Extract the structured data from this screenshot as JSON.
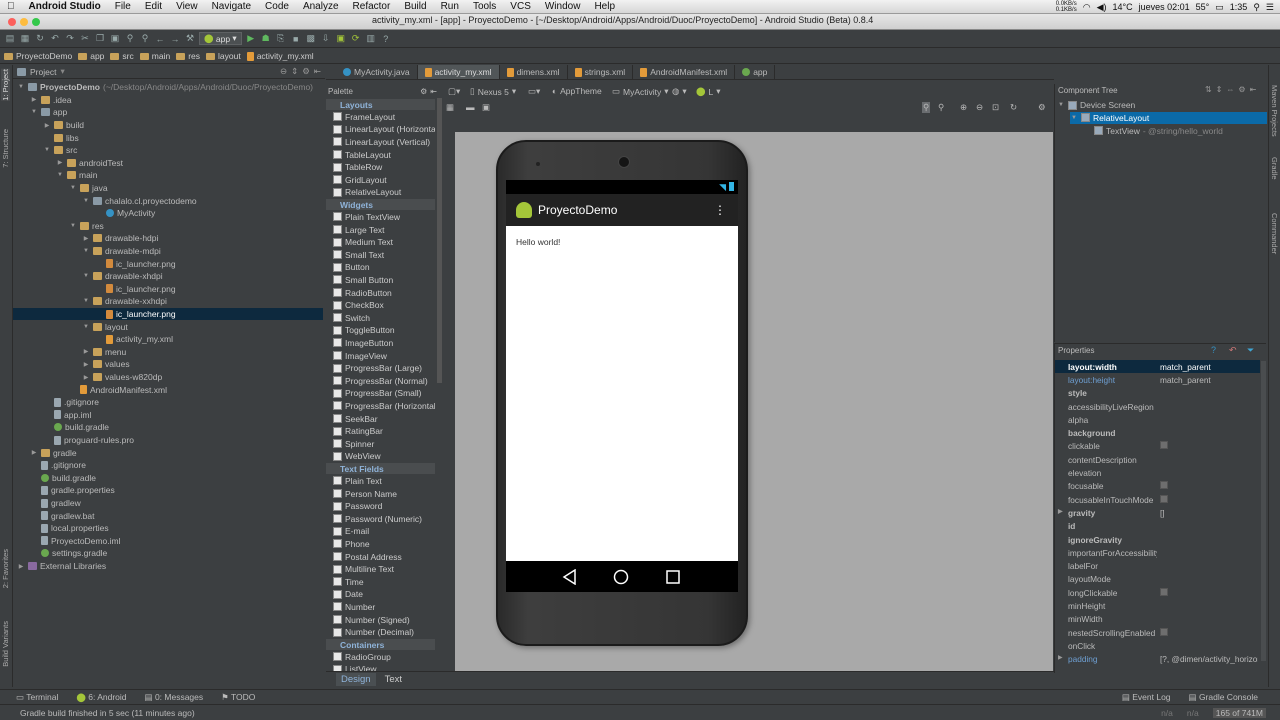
{
  "mac_menu": {
    "app_name": "Android Studio",
    "items": [
      "File",
      "Edit",
      "View",
      "Navigate",
      "Code",
      "Analyze",
      "Refactor",
      "Build",
      "Run",
      "Tools",
      "VCS",
      "Window",
      "Help"
    ]
  },
  "window_title": "activity_my.xml - [app] - ProyectoDemo - [~/Desktop/Android/Apps/Android/Duoc/ProyectoDemo] - Android Studio (Beta) 0.8.4",
  "tray": {
    "net_up": "0.0KB/s",
    "net_down": "0.1KB/s",
    "temp": "14°C",
    "cpu_temp": "55°",
    "clock_day": "jueves 02:01",
    "clock2": "1:35"
  },
  "toolbar": {
    "run_config": "app"
  },
  "breadcrumbs": [
    "ProyectoDemo",
    "app",
    "src",
    "main",
    "res",
    "layout",
    "activity_my.xml"
  ],
  "project_pane": {
    "view_name": "Project"
  },
  "tree": [
    {
      "d": 0,
      "arrow": "▼",
      "icon": "pkg",
      "label": "ProyectoDemo",
      "extra": "(~/Desktop/Android/Apps/Android/Duoc/ProyectoDemo)",
      "bold": true
    },
    {
      "d": 1,
      "arrow": "▶",
      "icon": "folder",
      "label": ".idea"
    },
    {
      "d": 1,
      "arrow": "▼",
      "icon": "pkg",
      "label": "app"
    },
    {
      "d": 2,
      "arrow": "▶",
      "icon": "folder",
      "label": "build"
    },
    {
      "d": 2,
      "arrow": "",
      "icon": "folder",
      "label": "libs"
    },
    {
      "d": 2,
      "arrow": "▼",
      "icon": "folder",
      "label": "src"
    },
    {
      "d": 3,
      "arrow": "▶",
      "icon": "folder",
      "label": "androidTest"
    },
    {
      "d": 3,
      "arrow": "▼",
      "icon": "folder",
      "label": "main"
    },
    {
      "d": 4,
      "arrow": "▼",
      "icon": "folder",
      "label": "java"
    },
    {
      "d": 5,
      "arrow": "▼",
      "icon": "pkg",
      "label": "chalalo.cl.proyectodemo"
    },
    {
      "d": 6,
      "arrow": "",
      "icon": "cls",
      "label": "MyActivity"
    },
    {
      "d": 4,
      "arrow": "▼",
      "icon": "folder",
      "label": "res"
    },
    {
      "d": 5,
      "arrow": "▶",
      "icon": "folder",
      "label": "drawable-hdpi"
    },
    {
      "d": 5,
      "arrow": "▼",
      "icon": "folder",
      "label": "drawable-mdpi"
    },
    {
      "d": 6,
      "arrow": "",
      "icon": "png",
      "label": "ic_launcher.png"
    },
    {
      "d": 5,
      "arrow": "▼",
      "icon": "folder",
      "label": "drawable-xhdpi"
    },
    {
      "d": 6,
      "arrow": "",
      "icon": "png",
      "label": "ic_launcher.png"
    },
    {
      "d": 5,
      "arrow": "▼",
      "icon": "folder",
      "label": "drawable-xxhdpi"
    },
    {
      "d": 6,
      "arrow": "",
      "icon": "png",
      "label": "ic_launcher.png",
      "sel": true
    },
    {
      "d": 5,
      "arrow": "▼",
      "icon": "folder",
      "label": "layout"
    },
    {
      "d": 6,
      "arrow": "",
      "icon": "xml",
      "label": "activity_my.xml"
    },
    {
      "d": 5,
      "arrow": "▶",
      "icon": "folder",
      "label": "menu"
    },
    {
      "d": 5,
      "arrow": "▶",
      "icon": "folder",
      "label": "values"
    },
    {
      "d": 5,
      "arrow": "▶",
      "icon": "folder",
      "label": "values-w820dp"
    },
    {
      "d": 4,
      "arrow": "",
      "icon": "xml",
      "label": "AndroidManifest.xml"
    },
    {
      "d": 2,
      "arrow": "",
      "icon": "file",
      "label": ".gitignore"
    },
    {
      "d": 2,
      "arrow": "",
      "icon": "file",
      "label": "app.iml"
    },
    {
      "d": 2,
      "arrow": "",
      "icon": "gradle",
      "label": "build.gradle"
    },
    {
      "d": 2,
      "arrow": "",
      "icon": "file",
      "label": "proguard-rules.pro"
    },
    {
      "d": 1,
      "arrow": "▶",
      "icon": "folder",
      "label": "gradle"
    },
    {
      "d": 1,
      "arrow": "",
      "icon": "file",
      "label": ".gitignore"
    },
    {
      "d": 1,
      "arrow": "",
      "icon": "gradle",
      "label": "build.gradle"
    },
    {
      "d": 1,
      "arrow": "",
      "icon": "file",
      "label": "gradle.properties"
    },
    {
      "d": 1,
      "arrow": "",
      "icon": "file",
      "label": "gradlew"
    },
    {
      "d": 1,
      "arrow": "",
      "icon": "file",
      "label": "gradlew.bat"
    },
    {
      "d": 1,
      "arrow": "",
      "icon": "file",
      "label": "local.properties"
    },
    {
      "d": 1,
      "arrow": "",
      "icon": "file",
      "label": "ProyectoDemo.iml"
    },
    {
      "d": 1,
      "arrow": "",
      "icon": "gradle",
      "label": "settings.gradle"
    },
    {
      "d": 0,
      "arrow": "▶",
      "icon": "lib",
      "label": "External Libraries"
    }
  ],
  "editor_tabs": [
    {
      "label": "MyActivity.java",
      "icon": "cls",
      "active": false
    },
    {
      "label": "activity_my.xml",
      "icon": "xml",
      "active": true
    },
    {
      "label": "dimens.xml",
      "icon": "xml",
      "active": false
    },
    {
      "label": "strings.xml",
      "icon": "xml",
      "active": false
    },
    {
      "label": "AndroidManifest.xml",
      "icon": "xml",
      "active": false
    },
    {
      "label": "app",
      "icon": "gradle",
      "active": false
    }
  ],
  "palette": {
    "title": "Palette",
    "groups": [
      {
        "name": "Layouts",
        "items": [
          "FrameLayout",
          "LinearLayout (Horizontal)",
          "LinearLayout (Vertical)",
          "TableLayout",
          "TableRow",
          "GridLayout",
          "RelativeLayout"
        ]
      },
      {
        "name": "Widgets",
        "items": [
          "Plain TextView",
          "Large Text",
          "Medium Text",
          "Small Text",
          "Button",
          "Small Button",
          "RadioButton",
          "CheckBox",
          "Switch",
          "ToggleButton",
          "ImageButton",
          "ImageView",
          "ProgressBar (Large)",
          "ProgressBar (Normal)",
          "ProgressBar (Small)",
          "ProgressBar (Horizontal)",
          "SeekBar",
          "RatingBar",
          "Spinner",
          "WebView"
        ]
      },
      {
        "name": "Text Fields",
        "items": [
          "Plain Text",
          "Person Name",
          "Password",
          "Password (Numeric)",
          "E-mail",
          "Phone",
          "Postal Address",
          "Multiline Text",
          "Time",
          "Date",
          "Number",
          "Number (Signed)",
          "Number (Decimal)"
        ]
      },
      {
        "name": "Containers",
        "items": [
          "RadioGroup",
          "ListView"
        ]
      }
    ]
  },
  "designer": {
    "device": "Nexus 5",
    "theme": "AppTheme",
    "activity": "MyActivity",
    "api": "L"
  },
  "phone": {
    "app_title": "ProyectoDemo",
    "hello_text": "Hello world!"
  },
  "designer_tabs": {
    "design": "Design",
    "text": "Text"
  },
  "component_tree": {
    "title": "Component Tree",
    "nodes": [
      {
        "d": 0,
        "label": "Device Screen",
        "extra": ""
      },
      {
        "d": 1,
        "label": "RelativeLayout",
        "extra": "",
        "sel": true
      },
      {
        "d": 2,
        "label": "TextView",
        "extra": " - @string/hello_world"
      }
    ]
  },
  "properties": {
    "title": "Properties",
    "rows": [
      {
        "n": "layout:width",
        "v": "match_parent",
        "b": true,
        "sel": true
      },
      {
        "n": "layout:height",
        "v": "match_parent",
        "blue": true
      },
      {
        "n": "style",
        "v": "",
        "b": true
      },
      {
        "n": "accessibilityLiveRegion",
        "v": ""
      },
      {
        "n": "alpha",
        "v": ""
      },
      {
        "n": "background",
        "v": "",
        "b": true
      },
      {
        "n": "clickable",
        "v": "",
        "chk": true
      },
      {
        "n": "contentDescription",
        "v": ""
      },
      {
        "n": "elevation",
        "v": ""
      },
      {
        "n": "focusable",
        "v": "",
        "chk": true
      },
      {
        "n": "focusableInTouchMode",
        "v": "",
        "chk": true
      },
      {
        "n": "gravity",
        "v": "[]",
        "b": true,
        "exp": true
      },
      {
        "n": "id",
        "v": "",
        "b": true
      },
      {
        "n": "ignoreGravity",
        "v": "",
        "b": true
      },
      {
        "n": "importantForAccessibility",
        "v": ""
      },
      {
        "n": "labelFor",
        "v": ""
      },
      {
        "n": "layoutMode",
        "v": ""
      },
      {
        "n": "longClickable",
        "v": "",
        "chk": true
      },
      {
        "n": "minHeight",
        "v": ""
      },
      {
        "n": "minWidth",
        "v": ""
      },
      {
        "n": "nestedScrollingEnabled",
        "v": "",
        "chk": true
      },
      {
        "n": "onClick",
        "v": ""
      },
      {
        "n": "padding",
        "v": "[?, @dimen/activity_horizontal_margin]",
        "blue": true,
        "exp": true
      }
    ]
  },
  "side_tabs": {
    "project": "1: Project",
    "structure": "7: Structure",
    "favorites": "2: Favorites",
    "build_variants": "Build Variants",
    "maven": "Maven Projects",
    "gradle": "Gradle",
    "commander": "Commander"
  },
  "tool_tabs": [
    "Terminal",
    "6: Android",
    "0: Messages",
    "TODO"
  ],
  "tool_tabs_right": [
    "Event Log",
    "Gradle Console"
  ],
  "status": {
    "message": "Gradle build finished in 5 sec (11 minutes ago)",
    "na1": "n/a",
    "na2": "n/a",
    "memory": "165 of 741M"
  }
}
